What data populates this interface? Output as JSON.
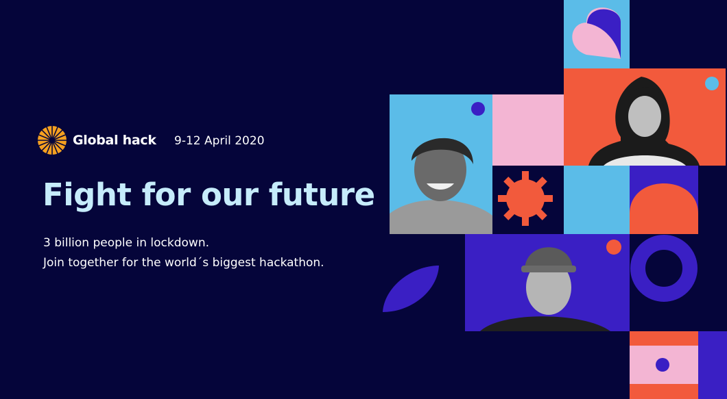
{
  "brand": {
    "name": "Global hack",
    "logo_icon": "sunburst-icon",
    "accent": "#f5a020"
  },
  "event": {
    "date": "9-12 April 2020"
  },
  "hero": {
    "headline": "Fight for our future",
    "line1": "3 billion people in lockdown.",
    "line2": "Join together for the world´s biggest hackathon."
  },
  "colors": {
    "background": "#05053a",
    "headline": "#c6ecfb",
    "light_blue": "#5bbce8",
    "pink": "#f3b5d3",
    "coral": "#f25a3c",
    "indigo": "#3a1fc4"
  }
}
